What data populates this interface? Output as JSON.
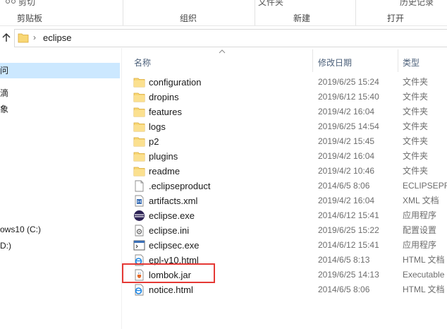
{
  "ribbon": {
    "groups": [
      {
        "top_label": "剪切",
        "label": "剪贴板"
      },
      {
        "top_label": "",
        "label": "组织"
      },
      {
        "top_label": "文件夹",
        "label": "新建"
      },
      {
        "top_label": "历史记录",
        "label": "打开"
      }
    ]
  },
  "address": {
    "crumb": "eclipse"
  },
  "nav": {
    "items": [
      {
        "label": "问",
        "selected": true
      },
      {
        "label": "滴",
        "selected": false
      },
      {
        "label": "象",
        "selected": false
      },
      {
        "label": "ows10 (C:)",
        "selected": false
      },
      {
        "label": "D:)",
        "selected": false
      }
    ]
  },
  "columns": {
    "name": "名称",
    "date": "修改日期",
    "type": "类型"
  },
  "files": [
    {
      "name": "configuration",
      "date": "2019/6/25 15:24",
      "type": "文件夹",
      "icon": "folder-icon"
    },
    {
      "name": "dropins",
      "date": "2019/6/12 15:40",
      "type": "文件夹",
      "icon": "folder-icon"
    },
    {
      "name": "features",
      "date": "2019/4/2 16:04",
      "type": "文件夹",
      "icon": "folder-icon"
    },
    {
      "name": "logs",
      "date": "2019/6/25 14:54",
      "type": "文件夹",
      "icon": "folder-icon"
    },
    {
      "name": "p2",
      "date": "2019/4/2 15:45",
      "type": "文件夹",
      "icon": "folder-icon"
    },
    {
      "name": "plugins",
      "date": "2019/4/2 16:04",
      "type": "文件夹",
      "icon": "folder-icon"
    },
    {
      "name": "readme",
      "date": "2019/4/2 10:46",
      "type": "文件夹",
      "icon": "folder-icon"
    },
    {
      "name": ".eclipseproduct",
      "date": "2014/6/5 8:06",
      "type": "ECLIPSEPRO",
      "icon": "file-icon"
    },
    {
      "name": "artifacts.xml",
      "date": "2019/4/2 16:04",
      "type": "XML 文档",
      "icon": "xml-file-icon"
    },
    {
      "name": "eclipse.exe",
      "date": "2014/6/12 15:41",
      "type": "应用程序",
      "icon": "eclipse-app-icon"
    },
    {
      "name": "eclipse.ini",
      "date": "2019/6/25 15:22",
      "type": "配置设置",
      "icon": "ini-file-icon"
    },
    {
      "name": "eclipsec.exe",
      "date": "2014/6/12 15:41",
      "type": "应用程序",
      "icon": "console-app-icon"
    },
    {
      "name": "epl-v10.html",
      "date": "2014/6/5 8:13",
      "type": "HTML 文档",
      "icon": "html-file-icon"
    },
    {
      "name": "lombok.jar",
      "date": "2019/6/25 14:13",
      "type": "Executable",
      "icon": "jar-file-icon"
    },
    {
      "name": "notice.html",
      "date": "2014/6/5 8:06",
      "type": "HTML 文档",
      "icon": "html-file-icon"
    }
  ],
  "colors": {
    "folder": "#f8d775",
    "selection": "#cce8ff",
    "highlight": "#e53935"
  }
}
